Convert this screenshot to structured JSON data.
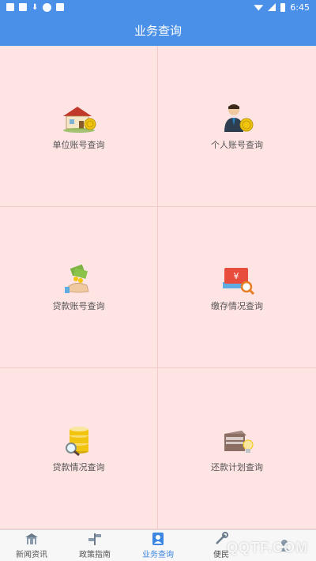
{
  "status_bar": {
    "time": "6:45",
    "icons": [
      "square-icon",
      "image-icon",
      "download-icon",
      "cn-badge-icon",
      "a-badge-icon",
      "wifi-icon",
      "signal-icon",
      "battery-icon"
    ]
  },
  "header": {
    "title": "业务查询"
  },
  "tiles": [
    {
      "label": "单位账号查询",
      "icon": "house-coin-icon"
    },
    {
      "label": "个人账号查询",
      "icon": "person-coin-icon"
    },
    {
      "label": "贷款账号查询",
      "icon": "hand-money-icon"
    },
    {
      "label": "缴存情况查询",
      "icon": "yuan-book-search-icon"
    },
    {
      "label": "贷款情况查询",
      "icon": "coins-magnifier-icon"
    },
    {
      "label": "还款计划查询",
      "icon": "box-bulb-icon"
    }
  ],
  "bottom_nav": [
    {
      "label": "新闻资讯",
      "icon": "building-icon",
      "active": false
    },
    {
      "label": "政策指南",
      "icon": "signpost-icon",
      "active": false
    },
    {
      "label": "业务查询",
      "icon": "person-card-icon",
      "active": true
    },
    {
      "label": "便民",
      "icon": "tools-icon",
      "active": false
    },
    {
      "label": "",
      "icon": "user-icon",
      "active": false
    }
  ],
  "watermark": "QQTF.COM",
  "colors": {
    "primary": "#4a90e8",
    "tile_bg": "#ffe4e4",
    "active_tab": "#3b86e0"
  }
}
